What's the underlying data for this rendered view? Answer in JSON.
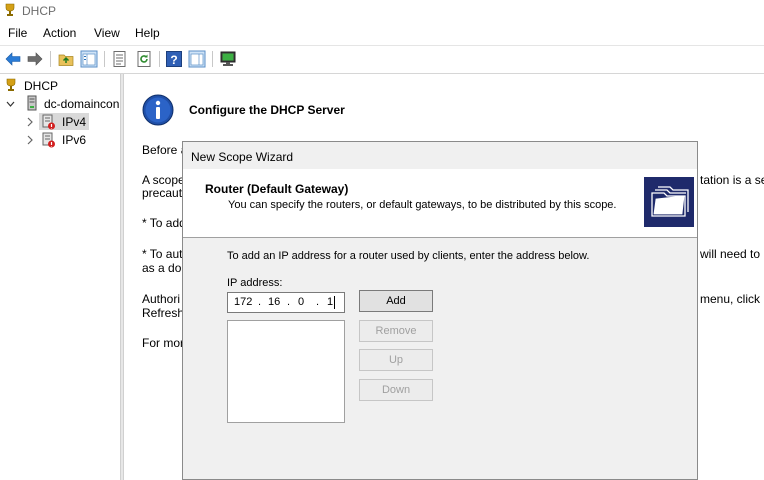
{
  "window": {
    "title": "DHCP"
  },
  "menu": [
    "File",
    "Action",
    "View",
    "Help"
  ],
  "toolbar": {
    "icons": [
      "back-arrow-icon",
      "forward-arrow-icon",
      "up-folder-icon",
      "show-hide-tree-icon",
      "export-list-icon",
      "refresh-icon",
      "help-icon",
      "show-action-pane-icon",
      "monitor-icon"
    ]
  },
  "tree": {
    "root": "DHCP",
    "server": "dc-domaincon",
    "ipv4": "IPv4",
    "ipv6": "IPv6"
  },
  "content": {
    "heading": "Configure the DHCP Server",
    "lines": [
      "Before a",
      "A scope",
      "precauti",
      "* To add",
      "* To aut",
      "as a dor",
      "Authori",
      "Refresh.",
      "For mor"
    ],
    "right_lines": [
      "tation is a sec",
      "will need to",
      "menu, click"
    ]
  },
  "wizard": {
    "title": "New Scope Wizard",
    "header_title": "Router (Default Gateway)",
    "header_subtitle": "You can specify the routers, or default gateways, to be distributed by this scope.",
    "instruction": "To add an IP address for a router used by clients, enter the address below.",
    "ip_label": "IP address:",
    "ip_octets": [
      "172",
      "16",
      "0",
      "1"
    ],
    "buttons": {
      "add": "Add",
      "remove": "Remove",
      "up": "Up",
      "down": "Down"
    }
  }
}
